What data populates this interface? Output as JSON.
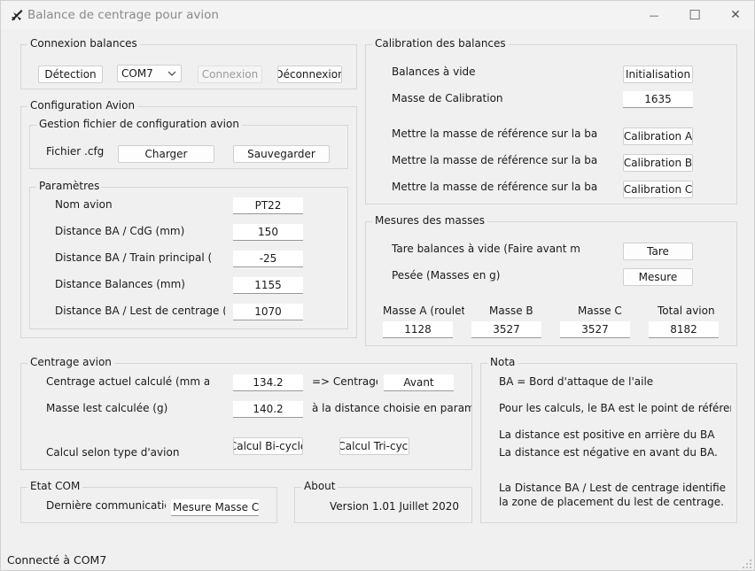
{
  "window": {
    "title": "Balance de centrage pour avion",
    "minimize_glyph": "—",
    "maximize_glyph": "☐",
    "close_glyph": "✕"
  },
  "connexion": {
    "legend": "Connexion balances",
    "detect_label": "Détection",
    "port_value": "COM7",
    "connect_label": "Connexion",
    "disconnect_label": "Déconnexion"
  },
  "config": {
    "legend": "Configuration Avion",
    "file_group": {
      "legend": "Gestion fichier de configuration avion",
      "file_label": "Fichier .cfg",
      "load_label": "Charger",
      "save_label": "Sauvegarder"
    },
    "params": {
      "legend": "Paramètres",
      "rows": [
        {
          "label": "Nom avion",
          "value": "PT22"
        },
        {
          "label": "Distance BA / CdG (mm)",
          "value": "150"
        },
        {
          "label": "Distance BA / Train principal (",
          "value": "-25"
        },
        {
          "label": "Distance Balances (mm)",
          "value": "1155"
        },
        {
          "label": "Distance BA / Lest de centrage (n",
          "value": "1070"
        }
      ]
    }
  },
  "calibration": {
    "legend": "Calibration des balances",
    "empty_label": "Balances à vide",
    "init_label": "Initialisation",
    "mass_label": "Masse de Calibration",
    "mass_value": "1635",
    "ref_rows": [
      {
        "label": "Mettre la masse de référence sur la bala",
        "button": "Calibration A"
      },
      {
        "label": "Mettre la masse de référence sur la bala",
        "button": "Calibration B"
      },
      {
        "label": "Mettre la masse de référence sur la bala",
        "button": "Calibration C"
      }
    ]
  },
  "mesures": {
    "legend": "Mesures des masses",
    "tare_text": "Tare balances à vide (Faire avant me",
    "tare_label": "Tare",
    "pesee_text": "Pesée (Masses en g)",
    "mesure_label": "Mesure",
    "columns": [
      {
        "label": "Masse A (roulet",
        "value": "1128"
      },
      {
        "label": "Masse B",
        "value": "3527"
      },
      {
        "label": "Masse C",
        "value": "3527"
      },
      {
        "label": "Total avion",
        "value": "8182"
      }
    ]
  },
  "centrage": {
    "legend": "Centrage avion",
    "cg_label": "Centrage actuel calculé (mm au",
    "cg_value": "134.2",
    "arrow_text": "=> Centrage",
    "position_value": "Avant",
    "lest_label": "Masse lest calculée (g)",
    "lest_value": "140.2",
    "distance_text": "à la distance choisie en paramè",
    "calc_label": "Calcul selon type d'avion",
    "bicycle_label": "Calcul Bi-cycle",
    "tricycle_label": "Calcul Tri-cycl"
  },
  "nota": {
    "legend": "Nota",
    "lines": [
      "BA = Bord d'attaque de l'aile",
      "Pour les calculs, le BA est le  point de référen",
      "La distance est positive en arrière du BA",
      "La distance est négative en avant du BA.",
      "La Distance BA / Lest de centrage identifie",
      "la zone de placement du lest de centrage."
    ]
  },
  "etat": {
    "legend": "Etat COM",
    "last_label": "Dernière communicatio",
    "last_value": "Mesure Masse C"
  },
  "about": {
    "legend": "About",
    "version": "Version 1.01  Juillet 2020"
  },
  "status": {
    "text": "Connecté à COM7"
  }
}
